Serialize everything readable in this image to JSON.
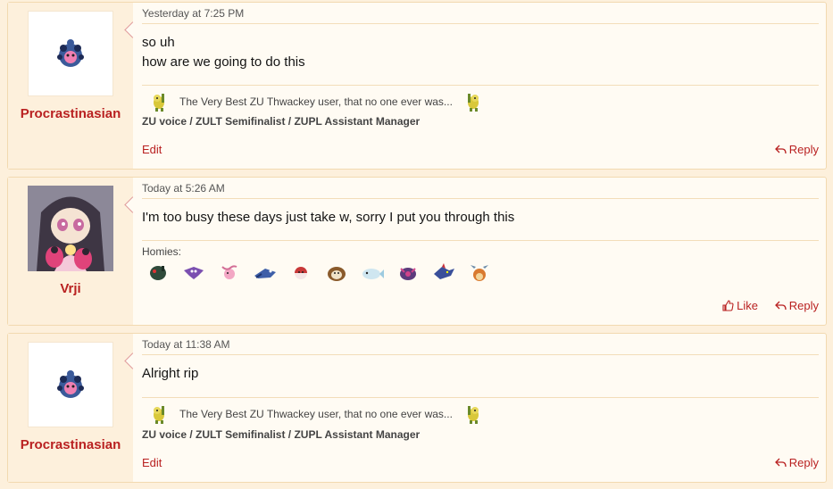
{
  "posts": [
    {
      "username": "Procrastinasian",
      "timestamp": "Yesterday at 7:25 PM",
      "lines": [
        "so uh",
        "how are we going to do this"
      ],
      "signature": {
        "text": "The Very Best ZU Thwackey user, that no one ever was...",
        "roles": "ZU voice / ZULT Semifinalist / ZUPL Assistant Manager"
      },
      "actions": {
        "edit": "Edit",
        "reply": "Reply"
      }
    },
    {
      "username": "Vrji",
      "timestamp": "Today at 5:26 AM",
      "lines": [
        "I'm too busy these days just take w, sorry I put you through this"
      ],
      "signature": {
        "label": "Homies:",
        "sprites": [
          "darkgreen-sprite-icon",
          "purple-bat-sprite-icon",
          "pink-sprite-icon",
          "blue-bird-sprite-icon",
          "red-ball-sprite-icon",
          "brown-mole-sprite-icon",
          "white-fish-sprite-icon",
          "purple-beetle-sprite-icon",
          "blue-shark-sprite-icon",
          "orange-dragon-sprite-icon"
        ]
      },
      "actions": {
        "like": "Like",
        "reply": "Reply"
      }
    },
    {
      "username": "Procrastinasian",
      "timestamp": "Today at 11:38 AM",
      "lines": [
        "Alright rip"
      ],
      "signature": {
        "text": "The Very Best ZU Thwackey user, that no one ever was...",
        "roles": "ZU voice / ZULT Semifinalist / ZUPL Assistant Manager"
      },
      "actions": {
        "edit": "Edit",
        "reply": "Reply"
      }
    }
  ],
  "colors": {
    "accent": "#b92121",
    "background": "#fdf0dc",
    "card": "#fffbf3"
  }
}
